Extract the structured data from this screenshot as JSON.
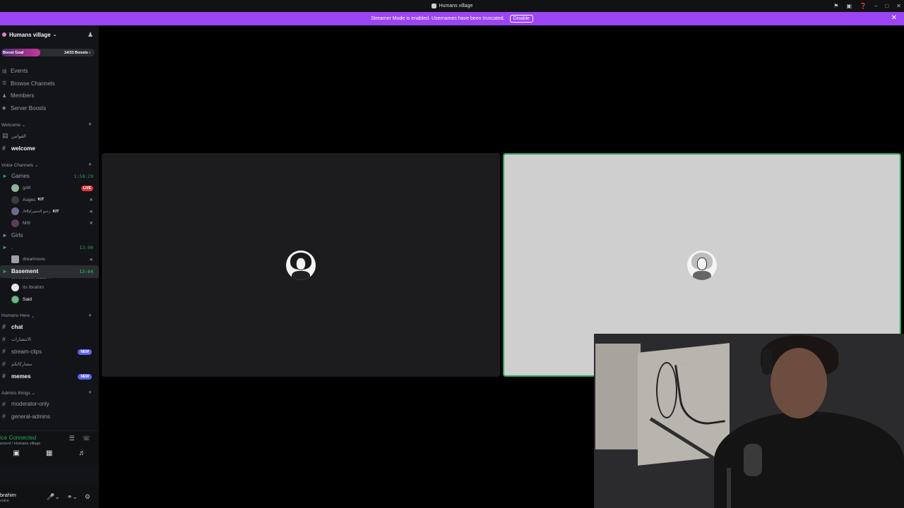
{
  "window": {
    "title": "Humans village"
  },
  "banner": {
    "text": "Streamer Mode is enabled. Usernames have been truncated.",
    "disable_label": "Disable"
  },
  "guild": {
    "name": "Humans village",
    "boost_label": "Boost Goal",
    "boost_count": "14/33 Boosts",
    "boost_progress": 0.42
  },
  "menu": [
    "Events",
    "Browse Channels",
    "Members",
    "Server Boosts"
  ],
  "categories": {
    "welcome": "Welcome",
    "voice": "Voice Channels",
    "humans": "Humans Here",
    "admins": "Admins things"
  },
  "welcome_channels": [
    "القوانين",
    "welcome"
  ],
  "voice": {
    "games": {
      "name": "Games",
      "time": "1:58:29"
    },
    "games_users": [
      {
        "name": "gzill",
        "badge": "LIVE"
      },
      {
        "name": "Auges",
        "tag": "KIT"
      },
      {
        "name": "Jelly(زخبو الحمير",
        "tag": "KIT"
      },
      {
        "name": "MI9"
      }
    ],
    "girls": {
      "name": "Girls"
    },
    "dot": {
      "name": ".",
      "time": "13:00"
    },
    "dot_users": [
      {
        "name": "dreamoore."
      }
    ],
    "basement": {
      "name": "Basement",
      "time": "12:04",
      "status": "Set a channel status"
    },
    "basement_users": [
      {
        "name": "Its Ibrahim"
      },
      {
        "name": "Said"
      }
    ]
  },
  "humans_channels": [
    {
      "name": "chat",
      "bright": true
    },
    {
      "name": "الانتصارات"
    },
    {
      "name": "stream-clips",
      "badge": "NEW"
    },
    {
      "name": "مشاركاتكم"
    },
    {
      "name": "memes",
      "bright": true,
      "badge": "NEW"
    }
  ],
  "admin_channels": [
    "moderator-only",
    "general-admins"
  ],
  "voice_connection": {
    "status": "ice Connected",
    "location": "ement / Humans village"
  },
  "user_panel": {
    "name": "brahim",
    "status": "voice"
  },
  "colors": {
    "accent": "#9b44f3",
    "online": "#23a55a",
    "badge": "#5865f2",
    "live": "#da373c"
  }
}
